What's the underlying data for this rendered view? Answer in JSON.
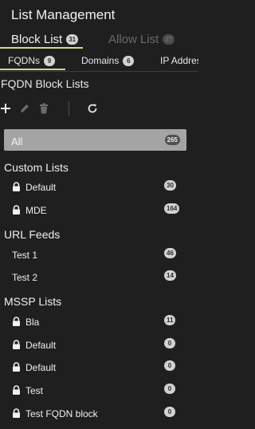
{
  "header": {
    "title": "List Management"
  },
  "main_tabs": [
    {
      "label": "Block List",
      "count": "31"
    },
    {
      "label": "Allow List",
      "count": "27"
    }
  ],
  "sub_tabs": [
    {
      "label": "FQDNs",
      "count": "9"
    },
    {
      "label": "Domains",
      "count": "6"
    },
    {
      "label": "IP Address"
    }
  ],
  "panel": {
    "title": "FQDN Block Lists"
  },
  "toolbar": {
    "icons": [
      "add-icon",
      "edit-icon",
      "delete-icon",
      "refresh-icon"
    ]
  },
  "list": {
    "all": {
      "label": "All",
      "count": "265"
    },
    "custom": {
      "label": "Custom Lists",
      "items": [
        {
          "label": "Default",
          "count": "30",
          "locked": true
        },
        {
          "label": "MDE",
          "count": "164",
          "locked": true
        }
      ]
    },
    "url_feeds": {
      "label": "URL Feeds",
      "items": [
        {
          "label": "Test 1",
          "count": "46",
          "locked": false
        },
        {
          "label": "Test 2",
          "count": "14",
          "locked": false
        }
      ]
    },
    "mssp": {
      "label": "MSSP Lists",
      "items": [
        {
          "label": "Bla",
          "count": "11",
          "locked": true
        },
        {
          "label": "Default",
          "count": "0",
          "locked": true
        },
        {
          "label": "Default",
          "count": "0",
          "locked": true
        },
        {
          "label": "Test",
          "count": "0",
          "locked": true
        },
        {
          "label": "Test FQDN block",
          "count": "0",
          "locked": true
        }
      ]
    }
  },
  "colors": {
    "background": "#1f1f1f",
    "accent_underline": "#cfd98f",
    "selected_row": "#a4a4a4",
    "pill": "#d2d2d2"
  }
}
